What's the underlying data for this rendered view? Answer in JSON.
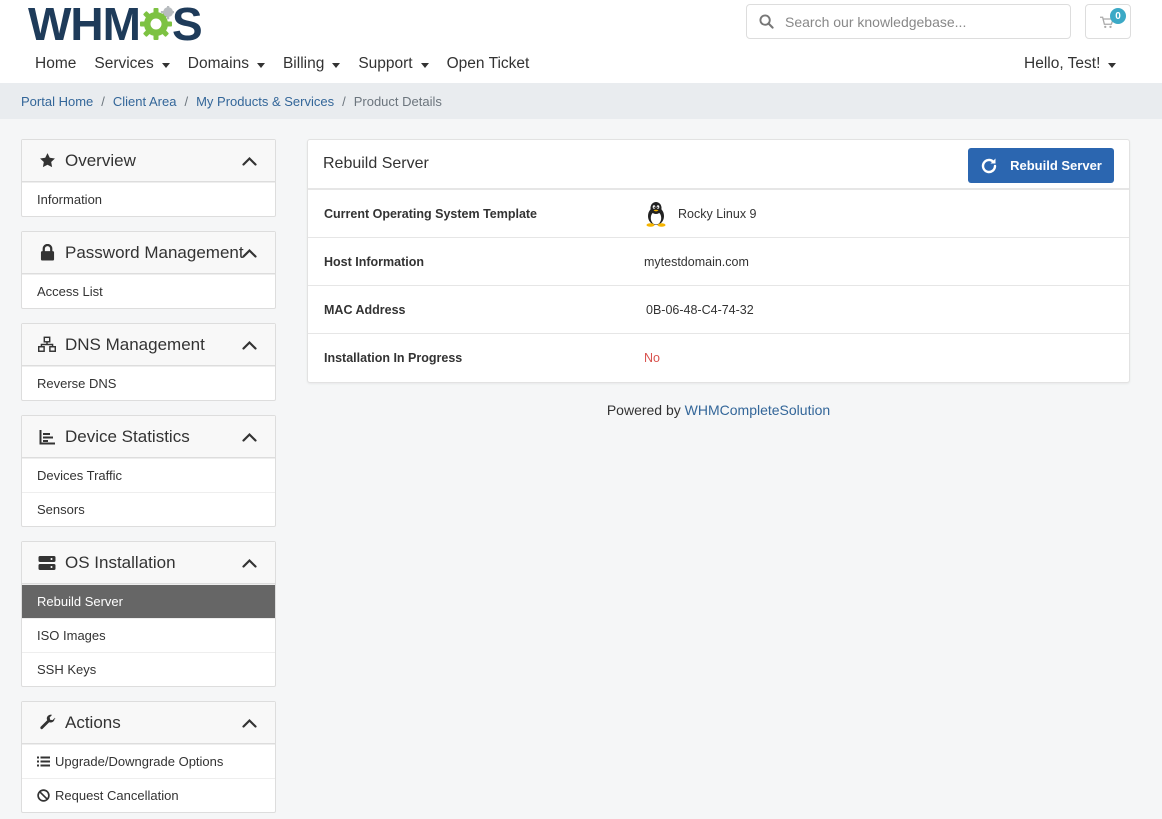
{
  "logo": {
    "text_left": "WHM",
    "text_right": "S"
  },
  "search": {
    "placeholder": "Search our knowledgebase..."
  },
  "cart": {
    "count": "0"
  },
  "nav": {
    "items": [
      {
        "label": "Home",
        "dropdown": false
      },
      {
        "label": "Services",
        "dropdown": true
      },
      {
        "label": "Domains",
        "dropdown": true
      },
      {
        "label": "Billing",
        "dropdown": true
      },
      {
        "label": "Support",
        "dropdown": true
      },
      {
        "label": "Open Ticket",
        "dropdown": false
      }
    ],
    "user_label": "Hello, Test!"
  },
  "breadcrumb": {
    "items": [
      "Portal Home",
      "Client Area",
      "My Products & Services"
    ],
    "current": "Product Details"
  },
  "sidebar": {
    "panels": [
      {
        "title": "Overview",
        "icon": "star-icon",
        "items": [
          {
            "label": "Information"
          }
        ]
      },
      {
        "title": "Password Management",
        "icon": "lock-icon",
        "items": [
          {
            "label": "Access List"
          }
        ]
      },
      {
        "title": "DNS Management",
        "icon": "sitemap-icon",
        "items": [
          {
            "label": "Reverse DNS"
          }
        ]
      },
      {
        "title": "Device Statistics",
        "icon": "chart-icon",
        "items": [
          {
            "label": "Devices Traffic"
          },
          {
            "label": "Sensors"
          }
        ]
      },
      {
        "title": "OS Installation",
        "icon": "server-icon",
        "items": [
          {
            "label": "Rebuild Server",
            "active": true
          },
          {
            "label": "ISO Images"
          },
          {
            "label": "SSH Keys"
          }
        ]
      },
      {
        "title": "Actions",
        "icon": "wrench-icon",
        "items": [
          {
            "label": "Upgrade/Downgrade Options",
            "icon": "list-icon"
          },
          {
            "label": "Request Cancellation",
            "icon": "ban-icon"
          }
        ]
      }
    ]
  },
  "main": {
    "title": "Rebuild Server",
    "button_label": "Rebuild Server",
    "rows": [
      {
        "label": "Current Operating System Template",
        "value": "Rocky Linux 9",
        "icon": "linux-tux-icon"
      },
      {
        "label": "Host Information",
        "value": "mytestdomain.com"
      },
      {
        "label": "MAC Address",
        "value": "0B-06-48-C4-74-32"
      },
      {
        "label": "Installation In Progress",
        "value": "No",
        "color": "#d9534f"
      }
    ]
  },
  "footer": {
    "prefix": "Powered by",
    "link": "WHMCompleteSolution"
  },
  "colors": {
    "accent": "#2b66b0",
    "link": "#336699",
    "brand": "#1e3b5a",
    "gear": "#7dc242",
    "active_item": "#666666",
    "danger": "#d9534f"
  }
}
